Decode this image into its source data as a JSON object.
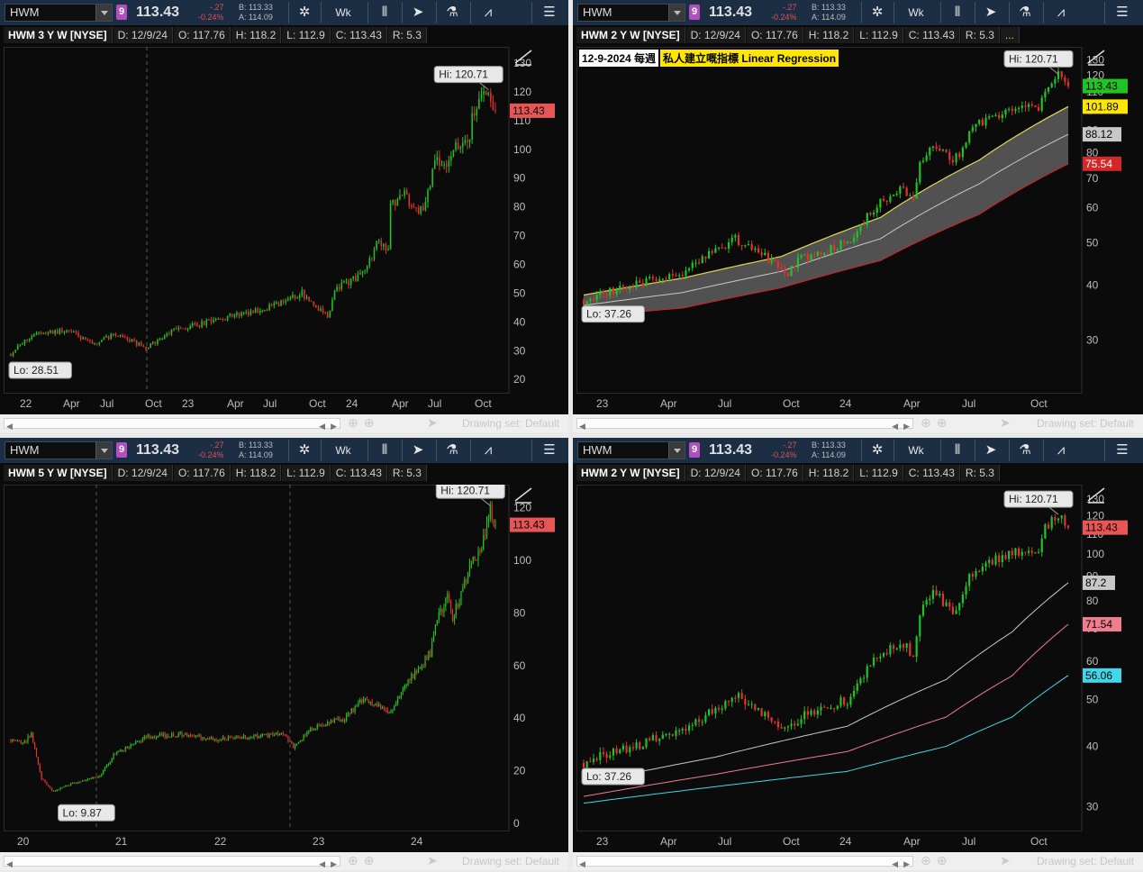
{
  "panels": [
    {
      "symbol": "HWM",
      "link_badge": "9",
      "last": "113.43",
      "change": "-.27",
      "change_pct": "-0.24%",
      "bid": "B: 113.33",
      "ask": "A: 114.09",
      "aggregation": "Wk",
      "header": {
        "title": "HWM 3 Y W [NYSE]",
        "date": "D: 12/9/24",
        "open": "O: 117.76",
        "high": "H: 118.2",
        "low": "L: 112.9",
        "close": "C: 113.43",
        "range": "R: 5.3"
      },
      "hi_bubble": "Hi: 120.71",
      "lo_bubble": "Lo: 28.51",
      "price_tag": "113.43",
      "drawing_set": "Drawing set: Default"
    },
    {
      "symbol": "HWM",
      "link_badge": "9",
      "last": "113.43",
      "change": "-.27",
      "change_pct": "-0.24%",
      "bid": "B: 113.33",
      "ask": "A: 114.09",
      "aggregation": "Wk",
      "header": {
        "title": "HWM 2 Y W [NYSE]",
        "date": "D: 12/9/24",
        "open": "O: 117.76",
        "high": "H: 118.2",
        "low": "L: 112.9",
        "close": "C: 113.43",
        "range": "R: 5.3",
        "more": "..."
      },
      "annotation_date": "12-9-2024 每週",
      "annotation_text": "私人建立嘅指標 Linear Regression",
      "hi_bubble": "Hi: 120.71",
      "lo_bubble": "Lo: 37.26",
      "price_tag": "113.43",
      "upper_tag": "101.89",
      "mid_tag": "88.12",
      "lower_tag": "75.54",
      "drawing_set": "Drawing set: Default"
    },
    {
      "symbol": "HWM",
      "link_badge": "9",
      "last": "113.43",
      "change": "-.27",
      "change_pct": "-0.24%",
      "bid": "B: 113.33",
      "ask": "A: 114.09",
      "aggregation": "Wk",
      "header": {
        "title": "HWM 5 Y W [NYSE]",
        "date": "D: 12/9/24",
        "open": "O: 117.76",
        "high": "H: 118.2",
        "low": "L: 112.9",
        "close": "C: 113.43",
        "range": "R: 5.3"
      },
      "hi_bubble": "Hi: 120.71",
      "lo_bubble": "Lo: 9.87",
      "price_tag": "113.43",
      "drawing_set": "Drawing set: Default"
    },
    {
      "symbol": "HWM",
      "link_badge": "9",
      "last": "113.43",
      "change": "-.27",
      "change_pct": "-0.24%",
      "bid": "B: 113.33",
      "ask": "A: 114.09",
      "aggregation": "Wk",
      "header": {
        "title": "HWM 2 Y W [NYSE]",
        "date": "D: 12/9/24",
        "open": "O: 117.76",
        "high": "H: 118.2",
        "low": "L: 112.9",
        "close": "C: 113.43",
        "range": "R: 5.3"
      },
      "hi_bubble": "Hi: 120.71",
      "lo_bubble": "Lo: 37.26",
      "price_tag": "113.43",
      "ma_tag_1": "87.2",
      "ma_tag_2": "71.54",
      "ma_tag_3": "56.06",
      "drawing_set": "Drawing set: Default"
    }
  ],
  "colors": {
    "up": "#22c322",
    "down": "#e53030",
    "price_tag": "#e85555",
    "upper_band": "#e7d84a",
    "lower_band": "#c8262b",
    "mid_band": "#c8c8c8",
    "ma_pink": "#f07c8e",
    "ma_cyan": "#40d8e8",
    "toolbar": "#1b2e44"
  },
  "chart_data": [
    {
      "type": "candlestick",
      "title": "HWM 3 Y W [NYSE]",
      "x_ticks": [
        "22",
        "Apr",
        "Jul",
        "Oct",
        "23",
        "Apr",
        "Jul",
        "Oct",
        "24",
        "Apr",
        "Jul",
        "Oct"
      ],
      "y_ticks": [
        20,
        30,
        40,
        50,
        60,
        70,
        80,
        90,
        100,
        110,
        120,
        130
      ],
      "ylim": [
        16,
        135
      ],
      "scale": "linear",
      "path": [
        [
          0,
          29
        ],
        [
          10,
          36
        ],
        [
          25,
          37
        ],
        [
          35,
          32
        ],
        [
          45,
          36
        ],
        [
          58,
          31
        ],
        [
          70,
          37
        ],
        [
          80,
          39
        ],
        [
          100,
          43
        ],
        [
          115,
          46
        ],
        [
          125,
          50
        ],
        [
          136,
          42
        ],
        [
          140,
          52
        ],
        [
          150,
          56
        ],
        [
          158,
          68
        ],
        [
          162,
          64
        ],
        [
          163,
          80
        ],
        [
          168,
          85
        ],
        [
          174,
          78
        ],
        [
          178,
          80
        ],
        [
          182,
          98
        ],
        [
          186,
          95
        ],
        [
          195,
          105
        ],
        [
          197,
          102
        ],
        [
          198,
          112
        ],
        [
          204,
          120
        ],
        [
          208,
          113
        ]
      ],
      "last_price": 113.43,
      "high": 120.71,
      "low": 28.51
    },
    {
      "type": "candlestick",
      "title": "HWM 2 Y W [NYSE]",
      "indicator": "Linear Regression",
      "x_ticks": [
        "23",
        "Apr",
        "Jul",
        "Oct",
        "24",
        "Apr",
        "Jul",
        "Oct"
      ],
      "y_ticks": [
        30,
        40,
        50,
        60,
        70,
        80,
        90,
        100,
        110,
        120,
        130
      ],
      "ylim": [
        23,
        138
      ],
      "scale": "log",
      "path": [
        [
          0,
          37
        ],
        [
          10,
          39
        ],
        [
          20,
          41
        ],
        [
          30,
          43
        ],
        [
          40,
          48
        ],
        [
          46,
          51
        ],
        [
          52,
          48
        ],
        [
          58,
          45
        ],
        [
          62,
          43
        ],
        [
          66,
          46
        ],
        [
          80,
          50
        ],
        [
          85,
          56
        ],
        [
          90,
          62
        ],
        [
          96,
          66
        ],
        [
          100,
          62
        ],
        [
          102,
          75
        ],
        [
          106,
          84
        ],
        [
          112,
          76
        ],
        [
          114,
          80
        ],
        [
          118,
          92
        ],
        [
          125,
          97
        ],
        [
          128,
          100
        ],
        [
          135,
          103
        ],
        [
          138,
          100
        ],
        [
          140,
          113
        ],
        [
          144,
          120
        ],
        [
          147,
          113.43
        ]
      ],
      "band_upper": [
        [
          0,
          38
        ],
        [
          30,
          41.5
        ],
        [
          60,
          46.5
        ],
        [
          90,
          57
        ],
        [
          120,
          77
        ],
        [
          147,
          101.89
        ]
      ],
      "band_mid": [
        [
          0,
          36
        ],
        [
          30,
          38.5
        ],
        [
          60,
          43
        ],
        [
          90,
          51
        ],
        [
          120,
          68
        ],
        [
          147,
          88.12
        ]
      ],
      "band_lower": [
        [
          0,
          34
        ],
        [
          30,
          35.5
        ],
        [
          60,
          39.5
        ],
        [
          90,
          45.5
        ],
        [
          120,
          58
        ],
        [
          147,
          75.54
        ]
      ],
      "last_price": 113.43,
      "high": 120.71,
      "low": 37.26
    },
    {
      "type": "candlestick",
      "title": "HWM 5 Y W [NYSE]",
      "x_ticks": [
        "20",
        "21",
        "22",
        "23",
        "24"
      ],
      "y_ticks": [
        0,
        20,
        40,
        60,
        80,
        100,
        120
      ],
      "ylim": [
        -2,
        128
      ],
      "scale": "linear",
      "path": [
        [
          0,
          32
        ],
        [
          8,
          31
        ],
        [
          12,
          34
        ],
        [
          18,
          17
        ],
        [
          25,
          12
        ],
        [
          35,
          15
        ],
        [
          52,
          18
        ],
        [
          60,
          26
        ],
        [
          80,
          33
        ],
        [
          100,
          34
        ],
        [
          120,
          32
        ],
        [
          140,
          33
        ],
        [
          160,
          34
        ],
        [
          165,
          29
        ],
        [
          175,
          36
        ],
        [
          195,
          40
        ],
        [
          205,
          47
        ],
        [
          215,
          45
        ],
        [
          222,
          42
        ],
        [
          230,
          53
        ],
        [
          240,
          60
        ],
        [
          245,
          65
        ],
        [
          250,
          80
        ],
        [
          255,
          85
        ],
        [
          258,
          78
        ],
        [
          262,
          85
        ],
        [
          270,
          100
        ],
        [
          275,
          105
        ],
        [
          280,
          120
        ],
        [
          283,
          113
        ]
      ],
      "last_price": 113.43,
      "high": 120.71,
      "low": 9.87
    },
    {
      "type": "candlestick",
      "title": "HWM 2 Y W [NYSE]",
      "indicator": "moving averages",
      "x_ticks": [
        "23",
        "Apr",
        "Jul",
        "Oct",
        "24",
        "Apr",
        "Jul",
        "Oct"
      ],
      "y_ticks": [
        30,
        40,
        50,
        60,
        70,
        80,
        90,
        100,
        110,
        120,
        130
      ],
      "ylim": [
        27,
        138
      ],
      "scale": "log",
      "path": [
        [
          0,
          37
        ],
        [
          10,
          39
        ],
        [
          20,
          41
        ],
        [
          30,
          43
        ],
        [
          40,
          48
        ],
        [
          46,
          51
        ],
        [
          52,
          48
        ],
        [
          58,
          45
        ],
        [
          62,
          43
        ],
        [
          66,
          46
        ],
        [
          80,
          50
        ],
        [
          85,
          56
        ],
        [
          90,
          62
        ],
        [
          96,
          66
        ],
        [
          100,
          62
        ],
        [
          102,
          75
        ],
        [
          106,
          84
        ],
        [
          112,
          76
        ],
        [
          114,
          80
        ],
        [
          118,
          92
        ],
        [
          125,
          97
        ],
        [
          128,
          100
        ],
        [
          135,
          103
        ],
        [
          138,
          100
        ],
        [
          140,
          113
        ],
        [
          144,
          120
        ],
        [
          147,
          113.43
        ]
      ],
      "ma_1": [
        [
          0,
          33.5
        ],
        [
          40,
          38
        ],
        [
          80,
          44
        ],
        [
          110,
          55
        ],
        [
          130,
          69
        ],
        [
          147,
          87.2
        ]
      ],
      "ma_2": [
        [
          0,
          31.5
        ],
        [
          40,
          35
        ],
        [
          80,
          39
        ],
        [
          110,
          46
        ],
        [
          130,
          56
        ],
        [
          147,
          71.54
        ]
      ],
      "ma_3": [
        [
          0,
          30.5
        ],
        [
          40,
          33
        ],
        [
          80,
          35.5
        ],
        [
          110,
          40
        ],
        [
          130,
          46
        ],
        [
          147,
          56.06
        ]
      ],
      "last_price": 113.43,
      "high": 120.71,
      "low": 37.26
    }
  ]
}
